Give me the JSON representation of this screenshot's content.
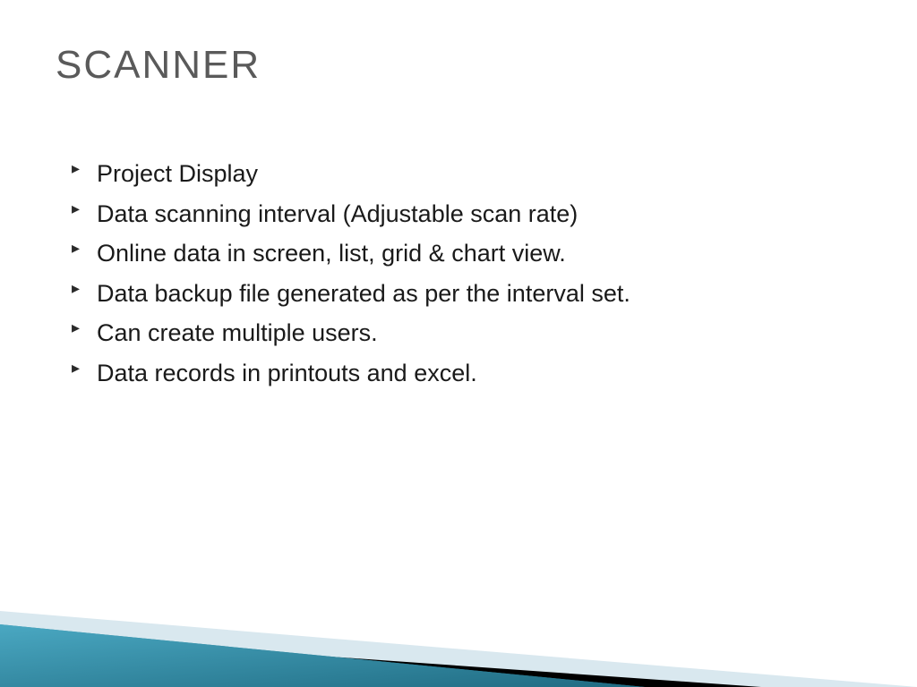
{
  "title": "SCANNER",
  "bullets": [
    "Project Display",
    "Data scanning interval (Adjustable scan rate)",
    "Online data in screen, list, grid & chart view.",
    "Data backup file generated as per the interval set.",
    "Can create multiple users.",
    "Data records in printouts and excel."
  ]
}
